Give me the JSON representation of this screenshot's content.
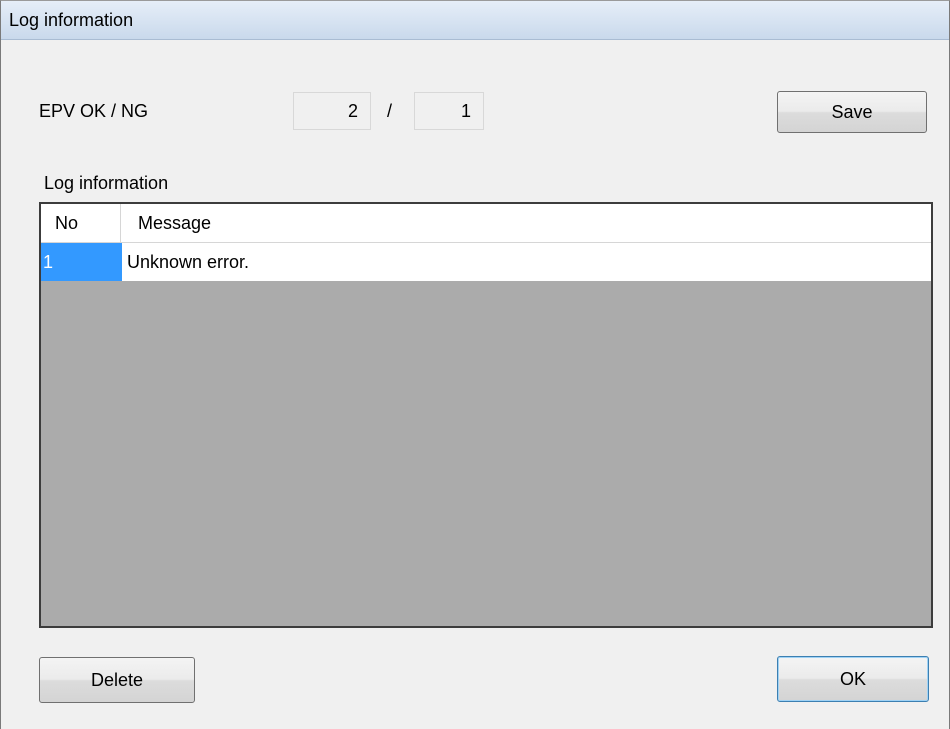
{
  "window": {
    "title": "Log information"
  },
  "epv": {
    "label": "EPV  OK / NG",
    "ok_value": "2",
    "separator": "/",
    "ng_value": "1"
  },
  "buttons": {
    "save": "Save",
    "delete": "Delete",
    "ok": "OK"
  },
  "log_section": {
    "label": "Log information"
  },
  "table": {
    "columns": [
      "No",
      "Message"
    ],
    "rows": [
      {
        "no": "1",
        "message": "Unknown error.",
        "selected": true
      }
    ]
  },
  "colors": {
    "selection": "#3399ff",
    "grid_empty_area": "#ababab",
    "title_bar": "#c9d9ec"
  }
}
